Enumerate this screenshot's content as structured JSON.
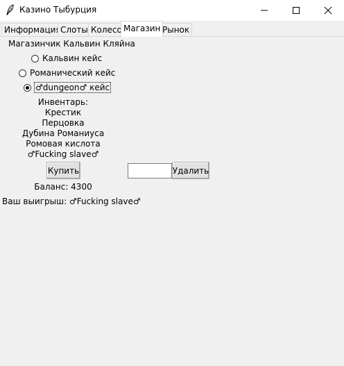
{
  "window": {
    "title": "Казино Тыбурция",
    "icon": "feather-icon"
  },
  "tabs": [
    {
      "label": "Информация",
      "active": false
    },
    {
      "label": "Слоты",
      "active": false
    },
    {
      "label": "Колесо",
      "active": false
    },
    {
      "label": "Магазин",
      "active": true
    },
    {
      "label": "Рынок",
      "active": false
    }
  ],
  "shop": {
    "heading": "Магазинчик Кальвин Кляйна",
    "radios": [
      {
        "label": "Кальвин кейс",
        "checked": false
      },
      {
        "label": "Романический кейс",
        "checked": false
      },
      {
        "label": "♂dungeon♂ кейс",
        "checked": true
      }
    ],
    "inventory_title": "Инвентарь:",
    "inventory_items": [
      "Крестик",
      "Перцовка",
      "Дубина Романиуса",
      "Ромовая кислота",
      "♂Fucking slave♂"
    ],
    "buy_label": "Купить",
    "delete_label": "Удалить",
    "delete_input_value": "",
    "balance": "Баланс: 4300",
    "win_text": "Ваш выигрыш: ♂Fucking slave♂"
  }
}
